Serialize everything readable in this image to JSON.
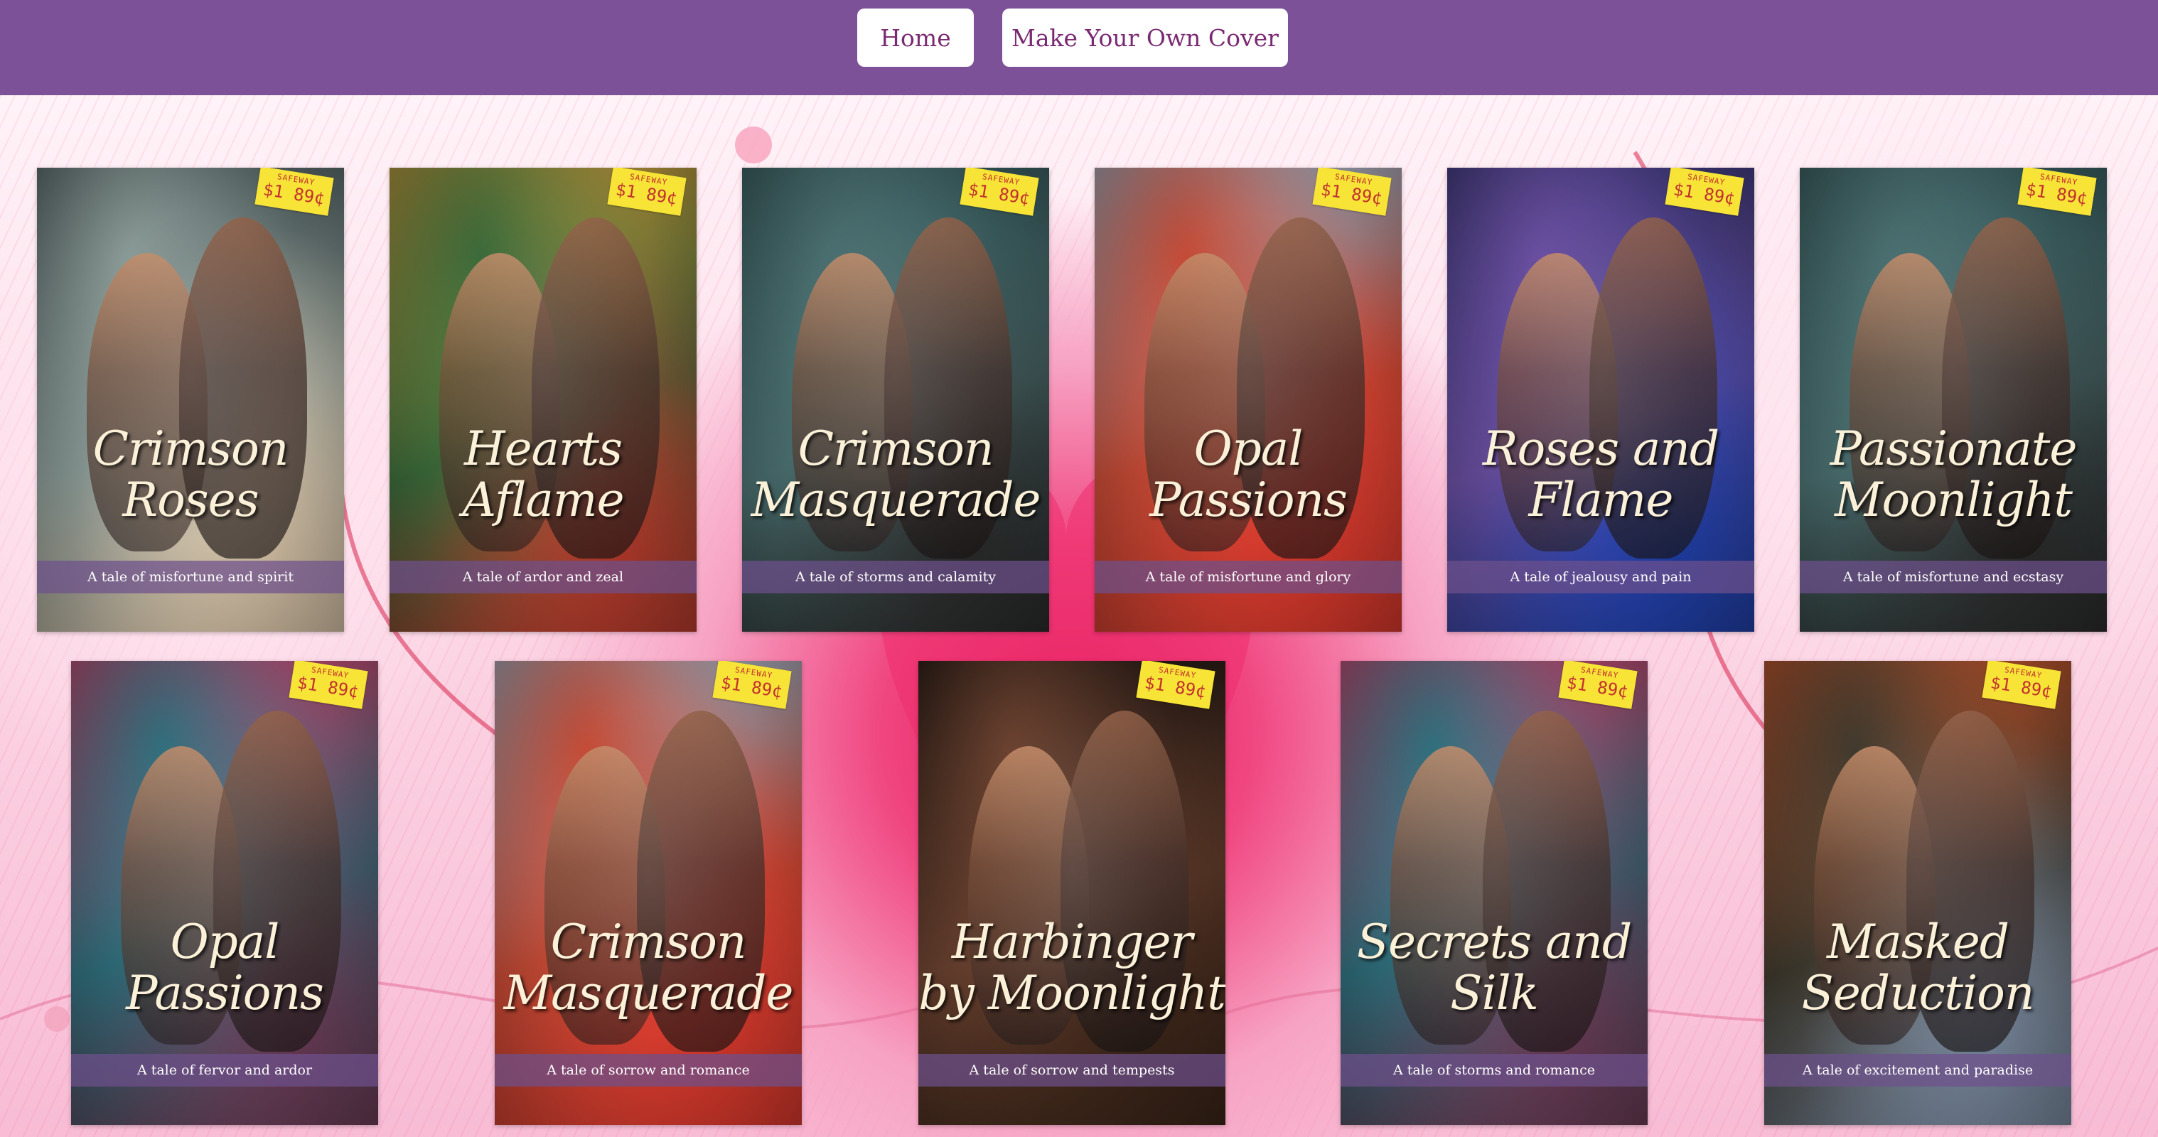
{
  "nav": {
    "home_label": "Home",
    "make_cover_label": "Make Your Own Cover"
  },
  "covers": [
    {
      "title_line1": "Crimson",
      "title_line2": "Roses",
      "tagline": "A tale of misfortune and spirit",
      "price_store": "SAFEWAY",
      "price": "$1 89¢",
      "palette": [
        "#3d4b4e",
        "#8a9a96",
        "#d9c4a8"
      ]
    },
    {
      "title_line1": "Hearts",
      "title_line2": "Aflame",
      "tagline": "A tale of ardor and zeal",
      "price_store": "SAFEWAY",
      "price": "$1 89¢",
      "palette": [
        "#e3a23b",
        "#3a6a3a",
        "#b83a2c"
      ]
    },
    {
      "title_line1": "Crimson",
      "title_line2": "Masquerade",
      "tagline": "A tale of storms and calamity",
      "price_store": "SAFEWAY",
      "price": "$1 89¢",
      "palette": [
        "#2e4f52",
        "#4b6f70",
        "#2a2a2a"
      ]
    },
    {
      "title_line1": "Opal",
      "title_line2": "Passions",
      "tagline": "A tale of misfortune and glory",
      "price_store": "SAFEWAY",
      "price": "$1 89¢",
      "palette": [
        "#8fc6e4",
        "#c44a35",
        "#d8382c"
      ]
    },
    {
      "title_line1": "Roses and",
      "title_line2": "Flame",
      "tagline": "A tale of jealousy and pain",
      "price_store": "SAFEWAY",
      "price": "$1 89¢",
      "palette": [
        "#2a2d66",
        "#6a4fa0",
        "#1f3fa8"
      ]
    },
    {
      "title_line1": "Passionate",
      "title_line2": "Moonlight",
      "tagline": "A tale of misfortune and ecstasy",
      "price_store": "SAFEWAY",
      "price": "$1 89¢",
      "palette": [
        "#2e4f52",
        "#4b6f70",
        "#2a2a2a"
      ]
    },
    {
      "title_line1": "Opal",
      "title_line2": "Passions",
      "tagline": "A tale of fervor and ardor",
      "price_store": "SAFEWAY",
      "price": "$1 89¢",
      "palette": [
        "#ec3a6a",
        "#2f6f7c",
        "#6a3b55"
      ]
    },
    {
      "title_line1": "Crimson",
      "title_line2": "Masquerade",
      "tagline": "A tale of sorrow and romance",
      "price_store": "SAFEWAY",
      "price": "$1 89¢",
      "palette": [
        "#8fc6e4",
        "#c44a35",
        "#d8382c"
      ]
    },
    {
      "title_line1": "Harbinger",
      "title_line2": "by Moonlight",
      "tagline": "A tale of sorrow and tempests",
      "price_store": "SAFEWAY",
      "price": "$1 89¢",
      "palette": [
        "#0c0a0a",
        "#6b4230",
        "#3a2418"
      ]
    },
    {
      "title_line1": "Secrets and",
      "title_line2": "Silk",
      "tagline": "A tale of storms and romance",
      "price_store": "SAFEWAY",
      "price": "$1 89¢",
      "palette": [
        "#ec3a6a",
        "#2f6f7c",
        "#6a3b55"
      ]
    },
    {
      "title_line1": "Masked",
      "title_line2": "Seduction",
      "tagline": "A tale of excitement and paradise",
      "price_store": "SAFEWAY",
      "price": "$1 89¢",
      "palette": [
        "#e05a2a",
        "#3f3a2e",
        "#7a8aa0"
      ]
    }
  ]
}
